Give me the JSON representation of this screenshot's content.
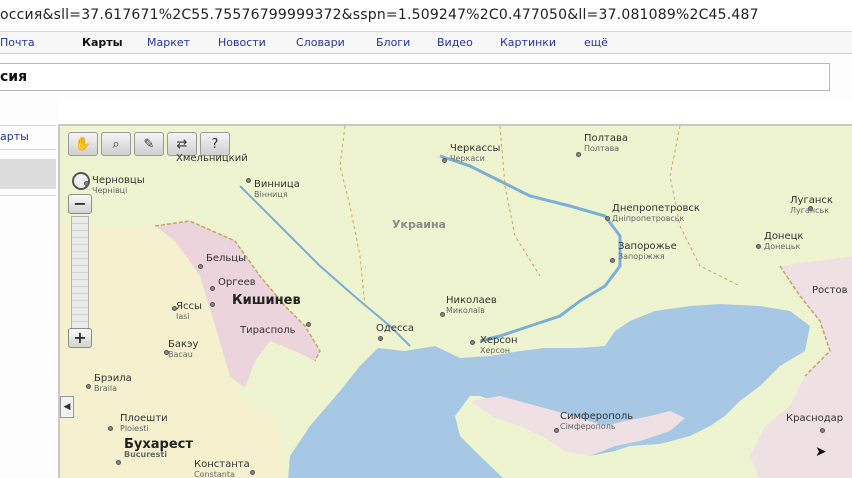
{
  "browser": {
    "url_fragment": "оссия&sll=37.617671%2C55.75576799999372&sspn=1.509247%2C0.477050&ll=37.081089%2C45.487"
  },
  "nav": {
    "items": [
      "Почта",
      "Карты",
      "Маркет",
      "Новости",
      "Словари",
      "Блоги",
      "Видео",
      "Картинки",
      "ещё"
    ],
    "active": "Карты"
  },
  "search": {
    "value": "сия"
  },
  "sidebar": {
    "tab_label": "арты"
  },
  "map": {
    "colors": {
      "land_ukraine": "#eef4cf",
      "land_moldova": "#ecd4dc",
      "land_romania": "#f5f1cf",
      "sea": "#a7c8e4",
      "land_russia": "#efe0e4",
      "border": "#c9a56c",
      "river": "#7ab0d8"
    },
    "tools": [
      "hand-icon",
      "zoom-box-icon",
      "ruler-icon",
      "route-icon",
      "question-icon"
    ],
    "zoom": {
      "plus": "+",
      "minus": "−"
    },
    "collapse_glyph": "◀",
    "country_label": "Украина",
    "cities": [
      {
        "name": "Хмельницкий",
        "sub": ""
      },
      {
        "name": "Черновцы",
        "sub": "Чернівці"
      },
      {
        "name": "Винница",
        "sub": "Вінниця"
      },
      {
        "name": "Черкассы",
        "sub": "Черкаси"
      },
      {
        "name": "Полтава",
        "sub": "Полтава"
      },
      {
        "name": "Днепропетровск",
        "sub": "Дніпропетровськ"
      },
      {
        "name": "Запорожье",
        "sub": "Запоріжжя"
      },
      {
        "name": "Донецк",
        "sub": "Донецьк"
      },
      {
        "name": "Луганск",
        "sub": "Луганськ"
      },
      {
        "name": "Бельцы",
        "sub": ""
      },
      {
        "name": "Оргеев",
        "sub": ""
      },
      {
        "name": "Кишинев",
        "sub": ""
      },
      {
        "name": "Тирасполь",
        "sub": ""
      },
      {
        "name": "Яссы",
        "sub": "Iasi"
      },
      {
        "name": "Бакэу",
        "sub": "Bacau"
      },
      {
        "name": "Николаев",
        "sub": "Миколаїв"
      },
      {
        "name": "Одесса",
        "sub": ""
      },
      {
        "name": "Херсон",
        "sub": "Херсон"
      },
      {
        "name": "Брэила",
        "sub": "Braila"
      },
      {
        "name": "Плоешти",
        "sub": "Ploiesti"
      },
      {
        "name": "Бухарест",
        "sub": "Bucuresti"
      },
      {
        "name": "Константа",
        "sub": "Constanta"
      },
      {
        "name": "Симферополь",
        "sub": "Сімферополь"
      },
      {
        "name": "Ростов",
        "sub": ""
      },
      {
        "name": "Краснодар",
        "sub": ""
      }
    ]
  }
}
